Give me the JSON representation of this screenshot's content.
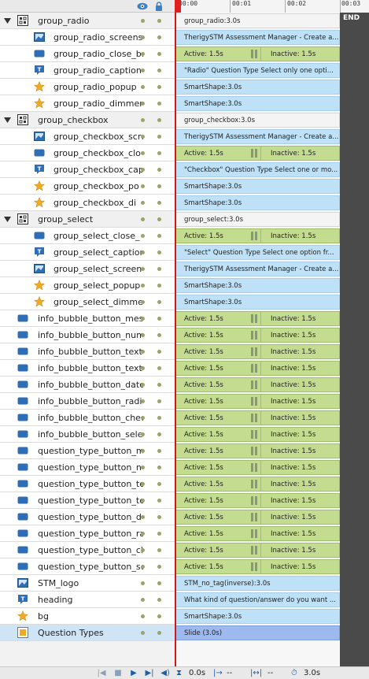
{
  "header": {
    "eye_icon": "eye-icon",
    "lock_icon": "lock-icon"
  },
  "ruler": {
    "ticks": [
      "00:00",
      "00:01",
      "00:02",
      "00:03"
    ],
    "end_label": "END"
  },
  "layers": [
    {
      "name": "group_radio",
      "kind": "group",
      "indent": 0,
      "icon": "group-icon"
    },
    {
      "name": "group_radio_screens",
      "kind": "child",
      "indent": 1,
      "icon": "image-icon"
    },
    {
      "name": "group_radio_close_ba",
      "kind": "child",
      "indent": 1,
      "icon": "button-icon"
    },
    {
      "name": "group_radio_caption",
      "kind": "child",
      "indent": 1,
      "icon": "caption-icon"
    },
    {
      "name": "group_radio_popup",
      "kind": "child",
      "indent": 1,
      "icon": "star-icon"
    },
    {
      "name": "group_radio_dimmer",
      "kind": "child",
      "indent": 1,
      "icon": "star-icon"
    },
    {
      "name": "group_checkbox",
      "kind": "group",
      "indent": 0,
      "icon": "group-icon"
    },
    {
      "name": "group_checkbox_scre",
      "kind": "child",
      "indent": 1,
      "icon": "image-icon"
    },
    {
      "name": "group_checkbox_clo",
      "kind": "child",
      "indent": 1,
      "icon": "button-icon"
    },
    {
      "name": "group_checkbox_capt",
      "kind": "child",
      "indent": 1,
      "icon": "caption-icon"
    },
    {
      "name": "group_checkbox_po",
      "kind": "child",
      "indent": 1,
      "icon": "star-icon"
    },
    {
      "name": "group_checkbox_di",
      "kind": "child",
      "indent": 1,
      "icon": "star-icon"
    },
    {
      "name": "group_select",
      "kind": "group",
      "indent": 0,
      "icon": "group-icon"
    },
    {
      "name": "group_select_close_",
      "kind": "child",
      "indent": 1,
      "icon": "button-icon"
    },
    {
      "name": "group_select_caption",
      "kind": "child",
      "indent": 1,
      "icon": "caption-icon"
    },
    {
      "name": "group_select_screen",
      "kind": "child",
      "indent": 1,
      "icon": "image-icon"
    },
    {
      "name": "group_select_popup",
      "kind": "child",
      "indent": 1,
      "icon": "star-icon"
    },
    {
      "name": "group_select_dimmer",
      "kind": "child",
      "indent": 1,
      "icon": "star-icon"
    },
    {
      "name": "info_bubble_button_mes",
      "kind": "item",
      "indent": 0,
      "icon": "button-icon"
    },
    {
      "name": "info_bubble_button_num",
      "kind": "item",
      "indent": 0,
      "icon": "button-icon"
    },
    {
      "name": "info_bubble_button_texta",
      "kind": "item",
      "indent": 0,
      "icon": "button-icon"
    },
    {
      "name": "info_bubble_button_text",
      "kind": "item",
      "indent": 0,
      "icon": "button-icon"
    },
    {
      "name": "info_bubble_button_date",
      "kind": "item",
      "indent": 0,
      "icon": "button-icon"
    },
    {
      "name": "info_bubble_button_radio",
      "kind": "item",
      "indent": 0,
      "icon": "button-icon"
    },
    {
      "name": "info_bubble_button_checa",
      "kind": "item",
      "indent": 0,
      "icon": "button-icon"
    },
    {
      "name": "info_bubble_button_select",
      "kind": "item",
      "indent": 0,
      "icon": "button-icon"
    },
    {
      "name": "question_type_button_ma",
      "kind": "item",
      "indent": 0,
      "icon": "button-icon"
    },
    {
      "name": "question_type_button_n",
      "kind": "item",
      "indent": 0,
      "icon": "button-icon"
    },
    {
      "name": "question_type_button_tex",
      "kind": "item",
      "indent": 0,
      "icon": "button-icon"
    },
    {
      "name": "question_type_button_tex",
      "kind": "item",
      "indent": 0,
      "icon": "button-icon"
    },
    {
      "name": "question_type_button_d",
      "kind": "item",
      "indent": 0,
      "icon": "button-icon"
    },
    {
      "name": "question_type_button_rad",
      "kind": "item",
      "indent": 0,
      "icon": "button-icon"
    },
    {
      "name": "question_type_button_che",
      "kind": "item",
      "indent": 0,
      "icon": "button-icon"
    },
    {
      "name": "question_type_button_sel",
      "kind": "item",
      "indent": 0,
      "icon": "button-icon"
    },
    {
      "name": "STM_logo",
      "kind": "item",
      "indent": 0,
      "icon": "image-icon"
    },
    {
      "name": "heading",
      "kind": "item",
      "indent": 0,
      "icon": "caption-icon"
    },
    {
      "name": "bg",
      "kind": "item",
      "indent": 0,
      "icon": "star-icon"
    },
    {
      "name": "Question Types",
      "kind": "slide",
      "indent": 0,
      "icon": "slide-icon"
    }
  ],
  "bars": [
    {
      "type": "white",
      "text": "group_radio:3.0s"
    },
    {
      "type": "blue",
      "text": "TherigySTM Assessment Manager - Create a..."
    },
    {
      "type": "green",
      "text": "Active: 1.5s",
      "inactive": "Inactive: 1.5s"
    },
    {
      "type": "blue",
      "text": "\"Radio\" Question Type Select only one opti..."
    },
    {
      "type": "blue",
      "text": "SmartShape:3.0s"
    },
    {
      "type": "blue",
      "text": "SmartShape:3.0s"
    },
    {
      "type": "white",
      "text": "group_checkbox:3.0s"
    },
    {
      "type": "blue",
      "text": "TherigySTM Assessment Manager - Create a..."
    },
    {
      "type": "green",
      "text": "Active: 1.5s",
      "inactive": "Inactive: 1.5s"
    },
    {
      "type": "blue",
      "text": "\"Checkbox\" Question Type Select one or mo..."
    },
    {
      "type": "blue",
      "text": "SmartShape:3.0s"
    },
    {
      "type": "blue",
      "text": "SmartShape:3.0s"
    },
    {
      "type": "white",
      "text": "group_select:3.0s"
    },
    {
      "type": "green",
      "text": "Active: 1.5s",
      "inactive": "Inactive: 1.5s"
    },
    {
      "type": "blue",
      "text": "\"Select\" Question Type Select one option fr..."
    },
    {
      "type": "blue",
      "text": "TherigySTM Assessment Manager - Create a..."
    },
    {
      "type": "blue",
      "text": "SmartShape:3.0s"
    },
    {
      "type": "blue",
      "text": "SmartShape:3.0s"
    },
    {
      "type": "green",
      "text": "Active: 1.5s",
      "inactive": "Inactive: 1.5s"
    },
    {
      "type": "green",
      "text": "Active: 1.5s",
      "inactive": "Inactive: 1.5s"
    },
    {
      "type": "green",
      "text": "Active: 1.5s",
      "inactive": "Inactive: 1.5s"
    },
    {
      "type": "green",
      "text": "Active: 1.5s",
      "inactive": "Inactive: 1.5s"
    },
    {
      "type": "green",
      "text": "Active: 1.5s",
      "inactive": "Inactive: 1.5s"
    },
    {
      "type": "green",
      "text": "Active: 1.5s",
      "inactive": "Inactive: 1.5s"
    },
    {
      "type": "green",
      "text": "Active: 1.5s",
      "inactive": "Inactive: 1.5s"
    },
    {
      "type": "green",
      "text": "Active: 1.5s",
      "inactive": "Inactive: 1.5s"
    },
    {
      "type": "green",
      "text": "Active: 1.5s",
      "inactive": "Inactive: 1.5s"
    },
    {
      "type": "green",
      "text": "Active: 1.5s",
      "inactive": "Inactive: 1.5s"
    },
    {
      "type": "green",
      "text": "Active: 1.5s",
      "inactive": "Inactive: 1.5s"
    },
    {
      "type": "green",
      "text": "Active: 1.5s",
      "inactive": "Inactive: 1.5s"
    },
    {
      "type": "green",
      "text": "Active: 1.5s",
      "inactive": "Inactive: 1.5s"
    },
    {
      "type": "green",
      "text": "Active: 1.5s",
      "inactive": "Inactive: 1.5s"
    },
    {
      "type": "green",
      "text": "Active: 1.5s",
      "inactive": "Inactive: 1.5s"
    },
    {
      "type": "green",
      "text": "Active: 1.5s",
      "inactive": "Inactive: 1.5s"
    },
    {
      "type": "blue",
      "text": "STM_no_tag(inverse):3.0s"
    },
    {
      "type": "blue",
      "text": "What kind of question/answer do you want ..."
    },
    {
      "type": "blue",
      "text": "SmartShape:3.0s"
    },
    {
      "type": "slide",
      "text": "Slide (3.0s)"
    }
  ],
  "footer": {
    "current_time": "0.0s",
    "start_time": "--",
    "duration": "--",
    "total_time": "3.0s"
  },
  "colors": {
    "playhead": "#d01818",
    "bar_blue": "#bfe1f7",
    "bar_green": "#c3dc8f",
    "bar_slide": "#9db9ee",
    "selected_row": "#cfe4f5"
  }
}
